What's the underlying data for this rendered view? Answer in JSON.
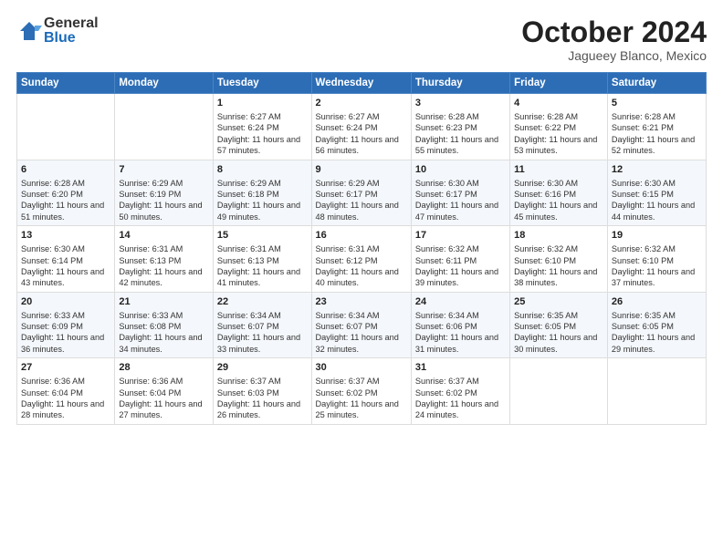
{
  "logo": {
    "general": "General",
    "blue": "Blue"
  },
  "header": {
    "month": "October 2024",
    "location": "Jagueey Blanco, Mexico"
  },
  "weekdays": [
    "Sunday",
    "Monday",
    "Tuesday",
    "Wednesday",
    "Thursday",
    "Friday",
    "Saturday"
  ],
  "weeks": [
    [
      {
        "day": "",
        "info": ""
      },
      {
        "day": "",
        "info": ""
      },
      {
        "day": "1",
        "info": "Sunrise: 6:27 AM\nSunset: 6:24 PM\nDaylight: 11 hours and 57 minutes."
      },
      {
        "day": "2",
        "info": "Sunrise: 6:27 AM\nSunset: 6:24 PM\nDaylight: 11 hours and 56 minutes."
      },
      {
        "day": "3",
        "info": "Sunrise: 6:28 AM\nSunset: 6:23 PM\nDaylight: 11 hours and 55 minutes."
      },
      {
        "day": "4",
        "info": "Sunrise: 6:28 AM\nSunset: 6:22 PM\nDaylight: 11 hours and 53 minutes."
      },
      {
        "day": "5",
        "info": "Sunrise: 6:28 AM\nSunset: 6:21 PM\nDaylight: 11 hours and 52 minutes."
      }
    ],
    [
      {
        "day": "6",
        "info": "Sunrise: 6:28 AM\nSunset: 6:20 PM\nDaylight: 11 hours and 51 minutes."
      },
      {
        "day": "7",
        "info": "Sunrise: 6:29 AM\nSunset: 6:19 PM\nDaylight: 11 hours and 50 minutes."
      },
      {
        "day": "8",
        "info": "Sunrise: 6:29 AM\nSunset: 6:18 PM\nDaylight: 11 hours and 49 minutes."
      },
      {
        "day": "9",
        "info": "Sunrise: 6:29 AM\nSunset: 6:17 PM\nDaylight: 11 hours and 48 minutes."
      },
      {
        "day": "10",
        "info": "Sunrise: 6:30 AM\nSunset: 6:17 PM\nDaylight: 11 hours and 47 minutes."
      },
      {
        "day": "11",
        "info": "Sunrise: 6:30 AM\nSunset: 6:16 PM\nDaylight: 11 hours and 45 minutes."
      },
      {
        "day": "12",
        "info": "Sunrise: 6:30 AM\nSunset: 6:15 PM\nDaylight: 11 hours and 44 minutes."
      }
    ],
    [
      {
        "day": "13",
        "info": "Sunrise: 6:30 AM\nSunset: 6:14 PM\nDaylight: 11 hours and 43 minutes."
      },
      {
        "day": "14",
        "info": "Sunrise: 6:31 AM\nSunset: 6:13 PM\nDaylight: 11 hours and 42 minutes."
      },
      {
        "day": "15",
        "info": "Sunrise: 6:31 AM\nSunset: 6:13 PM\nDaylight: 11 hours and 41 minutes."
      },
      {
        "day": "16",
        "info": "Sunrise: 6:31 AM\nSunset: 6:12 PM\nDaylight: 11 hours and 40 minutes."
      },
      {
        "day": "17",
        "info": "Sunrise: 6:32 AM\nSunset: 6:11 PM\nDaylight: 11 hours and 39 minutes."
      },
      {
        "day": "18",
        "info": "Sunrise: 6:32 AM\nSunset: 6:10 PM\nDaylight: 11 hours and 38 minutes."
      },
      {
        "day": "19",
        "info": "Sunrise: 6:32 AM\nSunset: 6:10 PM\nDaylight: 11 hours and 37 minutes."
      }
    ],
    [
      {
        "day": "20",
        "info": "Sunrise: 6:33 AM\nSunset: 6:09 PM\nDaylight: 11 hours and 36 minutes."
      },
      {
        "day": "21",
        "info": "Sunrise: 6:33 AM\nSunset: 6:08 PM\nDaylight: 11 hours and 34 minutes."
      },
      {
        "day": "22",
        "info": "Sunrise: 6:34 AM\nSunset: 6:07 PM\nDaylight: 11 hours and 33 minutes."
      },
      {
        "day": "23",
        "info": "Sunrise: 6:34 AM\nSunset: 6:07 PM\nDaylight: 11 hours and 32 minutes."
      },
      {
        "day": "24",
        "info": "Sunrise: 6:34 AM\nSunset: 6:06 PM\nDaylight: 11 hours and 31 minutes."
      },
      {
        "day": "25",
        "info": "Sunrise: 6:35 AM\nSunset: 6:05 PM\nDaylight: 11 hours and 30 minutes."
      },
      {
        "day": "26",
        "info": "Sunrise: 6:35 AM\nSunset: 6:05 PM\nDaylight: 11 hours and 29 minutes."
      }
    ],
    [
      {
        "day": "27",
        "info": "Sunrise: 6:36 AM\nSunset: 6:04 PM\nDaylight: 11 hours and 28 minutes."
      },
      {
        "day": "28",
        "info": "Sunrise: 6:36 AM\nSunset: 6:04 PM\nDaylight: 11 hours and 27 minutes."
      },
      {
        "day": "29",
        "info": "Sunrise: 6:37 AM\nSunset: 6:03 PM\nDaylight: 11 hours and 26 minutes."
      },
      {
        "day": "30",
        "info": "Sunrise: 6:37 AM\nSunset: 6:02 PM\nDaylight: 11 hours and 25 minutes."
      },
      {
        "day": "31",
        "info": "Sunrise: 6:37 AM\nSunset: 6:02 PM\nDaylight: 11 hours and 24 minutes."
      },
      {
        "day": "",
        "info": ""
      },
      {
        "day": "",
        "info": ""
      }
    ]
  ]
}
